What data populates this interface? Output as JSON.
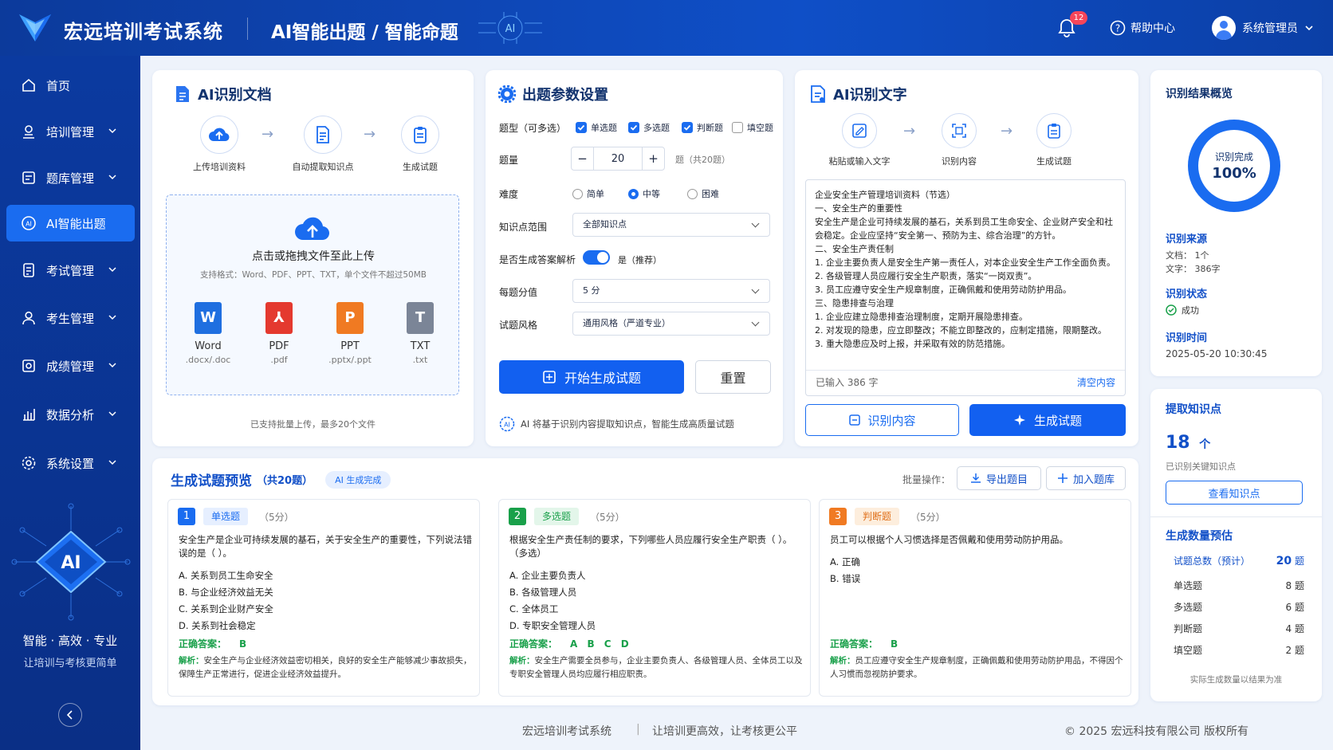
{
  "header": {
    "brand": "宏远培训考试系统",
    "title": "AI智能出题 / 智能命题",
    "chip_label": "AI",
    "notification_count": "12",
    "help": "帮助中心",
    "user": "系统管理员"
  },
  "sidebar": {
    "items": [
      {
        "label": "首页"
      },
      {
        "label": "培训管理"
      },
      {
        "label": "题库管理"
      },
      {
        "label": "AI智能出题"
      },
      {
        "label": "考试管理"
      },
      {
        "label": "考生管理"
      },
      {
        "label": "成绩管理"
      },
      {
        "label": "数据分析"
      },
      {
        "label": "系统设置"
      }
    ],
    "chip_label": "AI",
    "slogan1": "智能 · 高效 · 专业",
    "slogan2": "让培训与考核更简单"
  },
  "doc": {
    "title": "AI识别文档",
    "steps": [
      "上传培训资料",
      "自动提取知识点",
      "生成试题"
    ],
    "drop_title": "点击或拖拽文件至此上传",
    "drop_hint": "支持格式：Word、PDF、PPT、TXT，单个文件不超过50MB",
    "types": [
      {
        "name": "Word",
        "ext": ".docx/.doc",
        "glyph": "W",
        "color": "#1f6fe0"
      },
      {
        "name": "PDF",
        "ext": ".pdf",
        "glyph": "⅄",
        "color": "#e4392f"
      },
      {
        "name": "PPT",
        "ext": ".pptx/.ppt",
        "glyph": "P",
        "color": "#f07a22"
      },
      {
        "name": "TXT",
        "ext": ".txt",
        "glyph": "T",
        "color": "#7b8597"
      }
    ],
    "footer": "已支持批量上传，最多20个文件"
  },
  "params": {
    "title": "出题参数设置",
    "type_label": "题型（可多选）",
    "types": [
      {
        "label": "单选题",
        "checked": true
      },
      {
        "label": "多选题",
        "checked": true
      },
      {
        "label": "判断题",
        "checked": true
      },
      {
        "label": "填空题",
        "checked": false
      }
    ],
    "qty_label": "题量",
    "qty_minus": "−",
    "qty_value": "20",
    "qty_plus": "+",
    "qty_suffix": "题（共20题）",
    "diff_label": "难度",
    "diffs": [
      {
        "label": "简单",
        "on": false
      },
      {
        "label": "中等",
        "on": true
      },
      {
        "label": "困难",
        "on": false
      }
    ],
    "scope_label": "知识点范围",
    "scope_value": "全部知识点",
    "analysis_label": "是否生成答案解析",
    "analysis_value": "是（推荐）",
    "analysis_on": true,
    "score_label": "每题分值",
    "score_value": "5 分",
    "style_label": "试题风格",
    "style_value": "通用风格（严道专业）",
    "start_button": "开始生成试题",
    "reset_button": "重置",
    "note": "AI 将基于识别内容提取知识点，智能生成高质量试题"
  },
  "text": {
    "title": "AI识别文字",
    "steps": [
      "粘贴或输入文字",
      "识别内容",
      "生成试题"
    ],
    "content": "企业安全生产管理培训资料（节选）\n一、安全生产的重要性\n安全生产是企业可持续发展的基石，关系到员工生命安全、企业财产安全和社会稳定。企业应坚持“安全第一、预防为主、综合治理”的方针。\n二、安全生产责任制\n1. 企业主要负责人是安全生产第一责任人，对本企业安全生产工作全面负责。\n2. 各级管理人员应履行安全生产职责，落实“一岗双责”。\n3. 员工应遵守安全生产规章制度，正确佩戴和使用劳动防护用品。\n三、隐患排查与治理\n1. 企业应建立隐患排查治理制度，定期开展隐患排查。\n2. 对发现的隐患，应立即整改；不能立即整改的，应制定措施，限期整改。\n3. 重大隐患应及时上报，并采取有效的防范措施。",
    "count": "已输入  386 字",
    "clear": "清空内容",
    "recognize_button": "识别内容",
    "generate_button": "生成试题"
  },
  "result": {
    "title": "识别结果概览",
    "donut_label": "识别完成",
    "donut_value": "100%",
    "donut_fraction": 1.0,
    "source_label": "识别来源",
    "source_doc": "文档：  1个",
    "source_text": "文字：  386字",
    "status_label": "识别状态",
    "status_value": "成功",
    "time_label": "识别时间",
    "time_value": "2025-05-20  10:30:45"
  },
  "knowledge": {
    "title": "提取知识点",
    "count": "18",
    "unit": "个",
    "desc": "已识别关键知识点",
    "button": "查看知识点",
    "est_title": "生成数量预估",
    "est_total_label": "试题总数（预计）",
    "est_total_value": "20",
    "est_unit": "题",
    "est_rows": [
      {
        "label": "单选题",
        "value": "8"
      },
      {
        "label": "多选题",
        "value": "6"
      },
      {
        "label": "判断题",
        "value": "4"
      },
      {
        "label": "填空题",
        "value": "2"
      }
    ],
    "est_note": "实际生成数量以结果为准"
  },
  "preview": {
    "title": "生成试题预览",
    "count": "（共20题）",
    "tag": "AI 生成完成",
    "batch_label": "批量操作：",
    "export_button": "导出题目",
    "add_button": "加入题库",
    "answer_label": "正确答案：",
    "explain_label": "解析：",
    "questions": [
      {
        "num": "1",
        "type": "单选题",
        "score": "（5分）",
        "stem": "安全生产是企业可持续发展的基石，关于安全生产的重要性，下列说法错误的是（   ）。",
        "options": [
          "A.  关系到员工生命安全",
          "B.  与企业经济效益无关",
          "C.  关系到企业财产安全",
          "D.  关系到社会稳定"
        ],
        "answer": "B",
        "explain": "安全生产与企业经济效益密切相关，良好的安全生产能够减少事故损失，保障生产正常进行，促进企业经济效益提升。"
      },
      {
        "num": "2",
        "type": "多选题",
        "score": "（5分）",
        "stem": "根据安全生产责任制的要求，下列哪些人员应履行安全生产职责（   ）。（多选）",
        "options": [
          "A.  企业主要负责人",
          "B.  各级管理人员",
          "C.  全体员工",
          "D.  专职安全管理人员"
        ],
        "answer": "A B C D",
        "explain": "安全生产需要全员参与，企业主要负责人、各级管理人员、全体员工以及专职安全管理人员均应履行相应职责。"
      },
      {
        "num": "3",
        "type": "判断题",
        "score": "（5分）",
        "stem": "员工可以根据个人习惯选择是否佩戴和使用劳动防护用品。",
        "options": [
          "A.  正确",
          "B.  错误"
        ],
        "answer": "B",
        "explain": "员工应遵守安全生产规章制度，正确佩戴和使用劳动防护用品，不得因个人习惯而忽视防护要求。"
      }
    ]
  },
  "footer": {
    "name": "宏远培训考试系统",
    "sep": "|",
    "slogan": "让培训更高效，让考核更公平",
    "copyright": "© 2025 宏远科技有限公司   版权所有"
  },
  "colors": {
    "primary": "#1a6cf0",
    "header": "#0f4fc7",
    "success": "#19a04a"
  }
}
